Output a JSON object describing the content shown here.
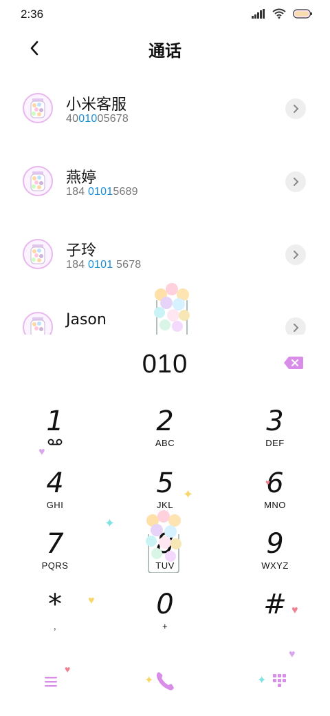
{
  "status_bar": {
    "time": "2:36"
  },
  "header": {
    "title": "通话"
  },
  "contacts": [
    {
      "name": "小米客服",
      "number_parts": [
        "40",
        "010",
        "05678"
      ]
    },
    {
      "name": "燕婷",
      "number_parts": [
        "184 ",
        "0101",
        "5689"
      ]
    },
    {
      "name": "子玲",
      "number_parts": [
        "184 ",
        "0101",
        " 5678"
      ]
    },
    {
      "name": "Jason",
      "number_parts": [
        "",
        "",
        ""
      ]
    }
  ],
  "dialer": {
    "number": "010"
  },
  "keypad": [
    {
      "digit": "1",
      "letters": ""
    },
    {
      "digit": "2",
      "letters": "ABC"
    },
    {
      "digit": "3",
      "letters": "DEF"
    },
    {
      "digit": "4",
      "letters": "GHI"
    },
    {
      "digit": "5",
      "letters": "JKL"
    },
    {
      "digit": "6",
      "letters": "MNO"
    },
    {
      "digit": "7",
      "letters": "PQRS"
    },
    {
      "digit": "8",
      "letters": "TUV"
    },
    {
      "digit": "9",
      "letters": "WXYZ"
    },
    {
      "digit": "*",
      "letters": ","
    },
    {
      "digit": "0",
      "letters": "+"
    },
    {
      "digit": "#",
      "letters": ""
    }
  ],
  "icons": {
    "back": "chevron-left-icon",
    "detail": "chevron-right-icon",
    "backspace": "backspace-icon",
    "voicemail": "voicemail-icon",
    "menu": "menu-icon",
    "call": "phone-icon",
    "dialpad": "dialpad-icon"
  },
  "colors": {
    "accent_purple": "#d88ee8",
    "highlight_blue": "#1a8fd6",
    "detail_bg": "#eeeeee"
  }
}
